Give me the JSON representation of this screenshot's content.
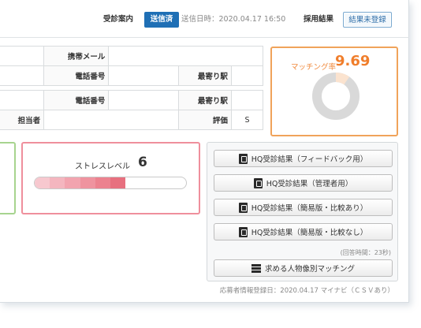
{
  "topbar": {
    "reception_label": "受診案内",
    "sent_badge": "送信済",
    "sent_datetime": "送信日時：2020.04.17 16:50",
    "result_label": "採用結果",
    "result_button": "結果未登録"
  },
  "info": {
    "mobile_mail_label": "携帯メール",
    "phone_label_1": "電話番号",
    "nearest_station_label_1": "最寄り駅",
    "phone_label_2": "電話番号",
    "nearest_station_label_2": "最寄り駅",
    "staff_label": "担当者",
    "rating_label": "評価",
    "rating_value": "S"
  },
  "matching": {
    "label": "マッチング率",
    "value": "9.69",
    "percent": 9.69,
    "colors": {
      "ring": "#d9d9d9",
      "accent": "#fbe3cf"
    }
  },
  "stress": {
    "label": "ストレスレベル",
    "value": "6",
    "level": 6,
    "max": 10,
    "colors": [
      "#f7c8cf",
      "#f4b6bf",
      "#f2a4af",
      "#ef939f",
      "#ec828f",
      "#e7707f"
    ]
  },
  "hq": {
    "buttons": [
      {
        "label": "HQ受診結果（フィードバック用）",
        "icon": "pdf-icon"
      },
      {
        "label": "HQ受診結果（管理者用）",
        "icon": "pdf-icon"
      },
      {
        "label": "HQ受診結果（簡易版・比較あり）",
        "icon": "pdf-icon"
      },
      {
        "label": "HQ受診結果（簡易版・比較なし）",
        "icon": "pdf-icon"
      }
    ],
    "answer_time": "(回答時間：23秒)",
    "matching_button": {
      "label": "求める人物像別マッチング",
      "icon": "grid-icon"
    }
  },
  "footer": {
    "registered": "応募者情報登録日：2020.04.17 マイナビ（ＣＳＶあり）"
  }
}
